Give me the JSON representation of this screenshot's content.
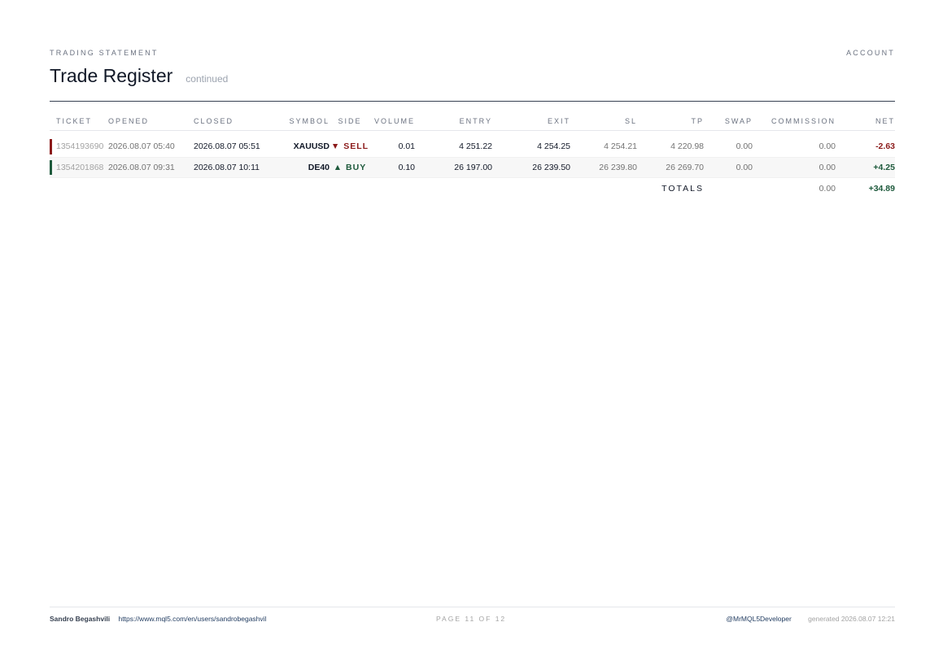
{
  "header": {
    "eyebrow": "TRADING STATEMENT",
    "account": "ACCOUNT",
    "title": "Trade Register",
    "subtitle": "continued"
  },
  "columns": {
    "ticket": "TICKET",
    "opened": "OPENED",
    "closed": "CLOSED",
    "symbol": "SYMBOL",
    "side": "SIDE",
    "volume": "VOLUME",
    "entry": "ENTRY",
    "exit": "EXIT",
    "sl": "SL",
    "tp": "TP",
    "swap": "SWAP",
    "commission": "COMMISSION",
    "net": "NET"
  },
  "rows": [
    {
      "ticket": "1354193690",
      "opened": "2026.08.07 05:40",
      "closed": "2026.08.07 05:51",
      "symbol": "XAUUSD",
      "side": "▼ SELL",
      "volume": "0.01",
      "entry": "4 251.22",
      "exit": "4 254.25",
      "sl": "4 254.21",
      "tp": "4 220.98",
      "swap": "0.00",
      "commission": "0.00",
      "net": "-2.63"
    },
    {
      "ticket": "1354201868",
      "opened": "2026.08.07 09:31",
      "closed": "2026.08.07 10:11",
      "symbol": "DE40",
      "side": "▲ BUY",
      "volume": "0.10",
      "entry": "26 197.00",
      "exit": "26 239.50",
      "sl": "26 239.80",
      "tp": "26 269.70",
      "swap": "0.00",
      "commission": "0.00",
      "net": "+4.25"
    }
  ],
  "totals": {
    "label": "TOTALS",
    "commission": "0.00",
    "net": "+34.89"
  },
  "footer": {
    "name": "Sandro Begashvili",
    "link": "https://www.mql5.com/en/users/sandrobegashvil",
    "page": "PAGE 11 OF 12",
    "handle": "@MrMQL5Developer",
    "generated": "generated 2026.08.07 12:21"
  },
  "colors": {
    "sell": "#8b1a1a",
    "buy": "#1e5a3c"
  }
}
